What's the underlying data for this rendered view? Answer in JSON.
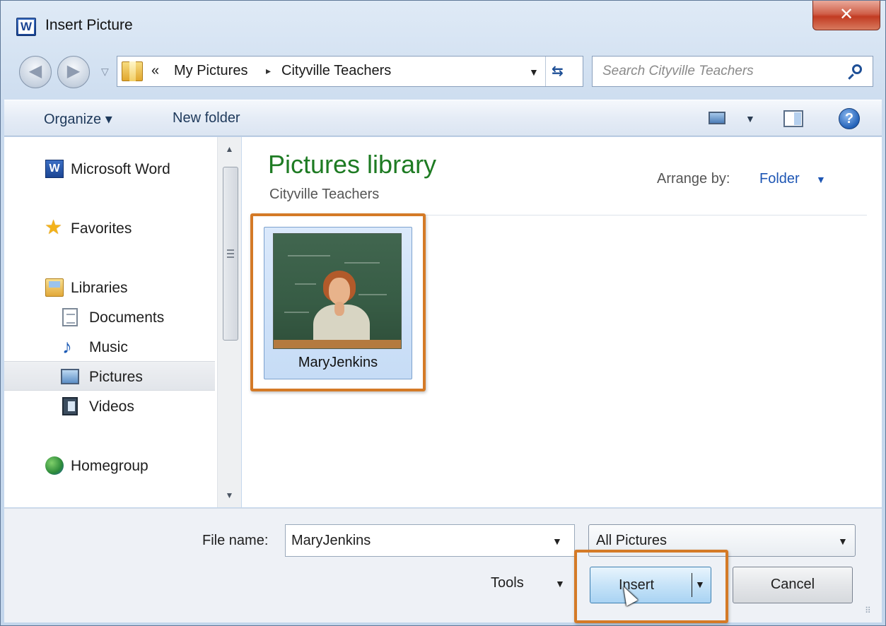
{
  "window": {
    "title": "Insert Picture",
    "app_icon": "W",
    "close_glyph": "✕"
  },
  "navigation": {
    "back_icon": "back-arrow-icon",
    "forward_icon": "forward-arrow-icon"
  },
  "address_bar": {
    "overflow": "«",
    "crumbs": [
      "My Pictures",
      "Cityville Teachers"
    ],
    "separator": "▸"
  },
  "search": {
    "placeholder": "Search Cityville Teachers"
  },
  "toolbar": {
    "organize_label": "Organize ▾",
    "new_folder_label": "New folder",
    "help_glyph": "?"
  },
  "sidebar": {
    "items": [
      {
        "label": "Microsoft Word",
        "icon": "word-icon"
      },
      {
        "label": "Favorites",
        "icon": "star-icon"
      },
      {
        "label": "Libraries",
        "icon": "libraries-icon"
      },
      {
        "label": "Documents",
        "icon": "documents-icon"
      },
      {
        "label": "Music",
        "icon": "music-icon"
      },
      {
        "label": "Pictures",
        "icon": "pictures-icon",
        "selected": true
      },
      {
        "label": "Videos",
        "icon": "videos-icon"
      },
      {
        "label": "Homegroup",
        "icon": "homegroup-icon"
      }
    ]
  },
  "content": {
    "library_title": "Pictures library",
    "library_subtitle": "Cityville Teachers",
    "arrange_label": "Arrange by:",
    "arrange_value": "Folder",
    "files": [
      {
        "name": "MaryJenkins",
        "selected": true
      }
    ]
  },
  "footer": {
    "file_name_label": "File name:",
    "file_name_value": "MaryJenkins",
    "filter_value": "All Pictures",
    "tools_label": "Tools",
    "insert_label": "Insert",
    "cancel_label": "Cancel"
  },
  "colors": {
    "accent_highlight": "#d47a27",
    "library_title": "#1e7b23",
    "link_blue": "#1e56b4"
  }
}
